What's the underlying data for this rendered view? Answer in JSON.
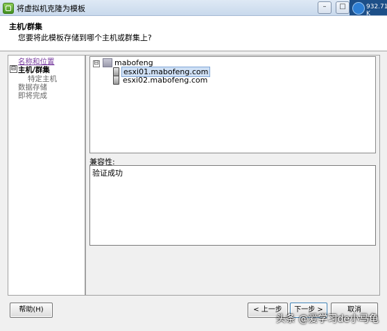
{
  "window": {
    "title": "将虚拟机克隆为模板",
    "tray_text": "932.71 K",
    "controls": {
      "minimize": "–",
      "maximize": "□",
      "close": "✕"
    }
  },
  "header": {
    "title": "主机/群集",
    "subtitle": "您要将此模板存储到哪个主机或群集上?"
  },
  "nav": {
    "items": [
      {
        "label": "名称和位置",
        "state": "link"
      },
      {
        "label": "主机/群集",
        "state": "current",
        "toggle": "⊟"
      },
      {
        "label": "特定主机",
        "state": "sub"
      },
      {
        "label": "数据存储",
        "state": "pending"
      },
      {
        "label": "即将完成",
        "state": "pending"
      }
    ]
  },
  "tree": {
    "toggle": "⊟",
    "datacenter": "mabofeng",
    "hosts": [
      {
        "label": "esxi01.mabofeng.com",
        "selected": true
      },
      {
        "label": "esxi02.mabofeng.com",
        "selected": false
      }
    ]
  },
  "compat": {
    "label": "兼容性:",
    "text": "验证成功"
  },
  "buttons": {
    "help": "帮助(H)",
    "back": "< 上一步",
    "next": "下一步 >",
    "cancel": "取消"
  },
  "watermark": "头条 @爱学习de小马龟",
  "colors": {
    "nav_link": "#7a3fa0",
    "selection": "#cfe0f5",
    "tray": "#1d4f88"
  }
}
